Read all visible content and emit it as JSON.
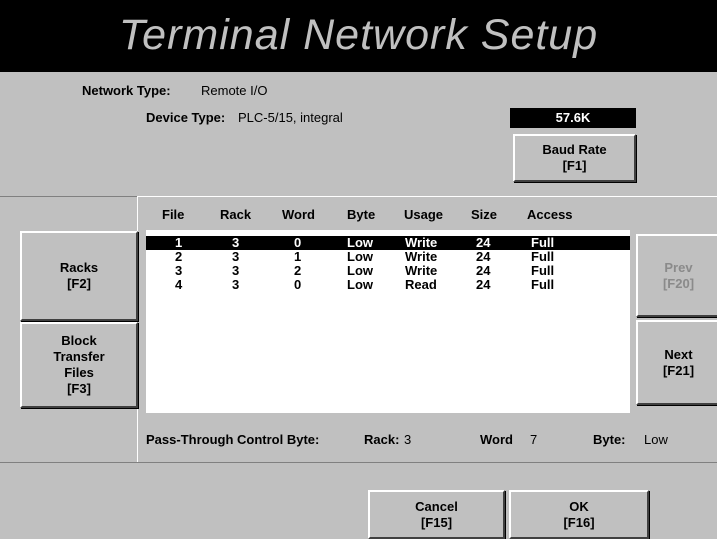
{
  "window": {
    "title": "Terminal Network Setup"
  },
  "network_type": {
    "label": "Network Type:",
    "value": "Remote I/O"
  },
  "device_type": {
    "label": "Device Type:",
    "value": "PLC-5/15, integral"
  },
  "baud": {
    "display": "57.6K",
    "button_line1": "Baud Rate",
    "button_line2": "[F1]"
  },
  "buttons": {
    "racks": {
      "line1": "Racks",
      "line2": "[F2]"
    },
    "block_transfer": {
      "line1": "Block",
      "line2": "Transfer",
      "line3": "Files",
      "line4": "[F3]"
    },
    "prev": {
      "line1": "Prev",
      "line2": "[F20]"
    },
    "next": {
      "line1": "Next",
      "line2": "[F21]"
    },
    "cancel": {
      "line1": "Cancel",
      "line2": "[F15]"
    },
    "ok": {
      "line1": "OK",
      "line2": "[F16]"
    }
  },
  "table": {
    "columns": [
      "File",
      "Rack",
      "Word",
      "Byte",
      "Usage",
      "Size",
      "Access"
    ],
    "rows": [
      [
        "1",
        "3",
        "0",
        "Low",
        "Write",
        "24",
        "Full"
      ],
      [
        "2",
        "3",
        "1",
        "Low",
        "Write",
        "24",
        "Full"
      ],
      [
        "3",
        "3",
        "2",
        "Low",
        "Write",
        "24",
        "Full"
      ],
      [
        "4",
        "3",
        "0",
        "Low",
        "Read",
        "24",
        "Full"
      ]
    ],
    "selected_row": 0
  },
  "pass_through": {
    "label": "Pass-Through Control Byte:",
    "rack_label": "Rack:",
    "rack_value": "3",
    "word_label": "Word",
    "word_value": "7",
    "byte_label": "Byte:",
    "byte_value": "Low"
  }
}
